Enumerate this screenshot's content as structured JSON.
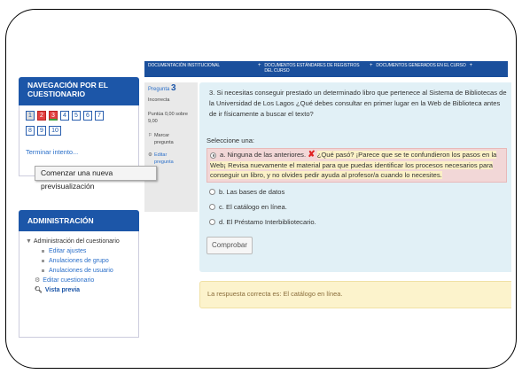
{
  "topnav": {
    "items": [
      "DOCUMENTACIÓN INSTITUCIONAL",
      "DOCUMENTOS ESTÁNDARES DE REGISTROS DEL CURSO",
      "DOCUMENTOS GENERADOS EN EL CURSO"
    ],
    "plus": "+"
  },
  "nav_block": {
    "title": "NAVEGACIÓN POR EL CUESTIONARIO",
    "numbers": [
      "1",
      "2",
      "3",
      "4",
      "5",
      "6",
      "7",
      "8",
      "9",
      "10"
    ],
    "finish_link": "Terminar intento..."
  },
  "tooltip": "Comenzar una nueva previsualización",
  "admin_block": {
    "title": "ADMINISTRACIÓN",
    "root": "Administración del cuestionario",
    "items": [
      "Editar ajustes",
      "Anulaciones de grupo",
      "Anulaciones de usuario",
      "Editar cuestionario",
      "Vista previa"
    ]
  },
  "info": {
    "question_label": "Pregunta",
    "question_number": "3",
    "status": "Incorrecta",
    "score": "Puntúa 0,00 sobre 9,00",
    "flag": "Marcar pregunta",
    "edit": "Editar pregunta"
  },
  "question": {
    "text": "3.   Si necesitas conseguir prestado un determinado libro que pertenece al Sistema de Bibliotecas de la Universidad de Los Lagos ¿Qué debes consultar en primer lugar en la Web de Biblioteca antes de ir físicamente a buscar el texto?",
    "select_label": "Seleccione una:",
    "selected_option": "a. Ninguna de las anteriores.",
    "feedback": "¿Qué pasó? ¡Parece que se te confundieron los pasos en la Web¡ Revisa nuevamente el material para que puedas identificar los procesos necesarios para conseguir un libro, y no olvides pedir  ayuda al profesor/a cuando lo necesites.",
    "options": [
      "b. Las bases de datos",
      "c. El catálogo en línea.",
      "d. El Préstamo Interbibliotecario."
    ],
    "check_button": "Comprobar"
  },
  "correct_answer": "La respuesta correcta es: El catálogo en línea.",
  "colors": {
    "nav_blue": "#1c56a8",
    "panel_blue": "#e1f0f6",
    "wrong_bg": "#f2d7d7",
    "correct_bg": "#fcf3cc"
  }
}
